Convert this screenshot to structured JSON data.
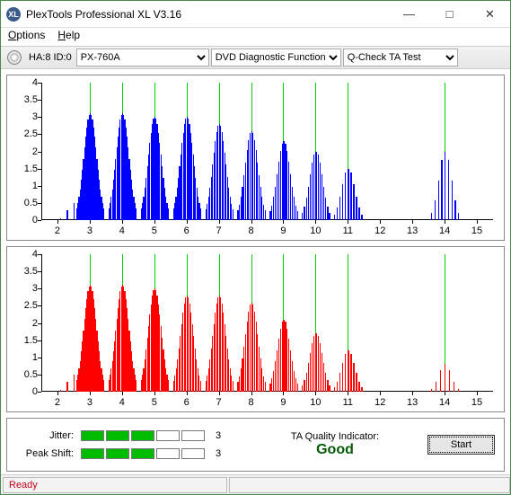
{
  "window": {
    "title": "PlexTools Professional XL V3.16",
    "icon_text": "XL",
    "minimize": "—",
    "maximize": "□",
    "close": "✕"
  },
  "menu": {
    "options": "Options",
    "options_u": "O",
    "help": "Help",
    "help_u": "H"
  },
  "toolbar": {
    "drive_label": "HA:8 ID:0",
    "drive_model": "PX-760A",
    "func": "DVD Diagnostic Functions",
    "test": "Q-Check TA Test"
  },
  "chart_data": [
    {
      "type": "bar",
      "color": "#0000ff",
      "xlim": [
        1.5,
        15.5
      ],
      "ylim": [
        0,
        4
      ],
      "xticks": [
        2,
        3,
        4,
        5,
        6,
        7,
        8,
        9,
        10,
        11,
        12,
        13,
        14,
        15
      ],
      "yticks": [
        0,
        0.5,
        1,
        1.5,
        2,
        2.5,
        3,
        3.5,
        4
      ],
      "vlines": [
        3,
        4,
        5,
        6,
        7,
        8,
        9,
        10,
        11,
        14
      ],
      "clusters": [
        {
          "center": 2.5,
          "npts": 5,
          "peak": 0.5
        },
        {
          "center": 3,
          "npts": 25,
          "peak": 3.1
        },
        {
          "center": 4,
          "npts": 25,
          "peak": 3.1
        },
        {
          "center": 5,
          "npts": 23,
          "peak": 3.0
        },
        {
          "center": 6,
          "npts": 23,
          "peak": 3.0
        },
        {
          "center": 7,
          "npts": 21,
          "peak": 2.8
        },
        {
          "center": 8,
          "npts": 19,
          "peak": 2.6
        },
        {
          "center": 9,
          "npts": 17,
          "peak": 2.3
        },
        {
          "center": 10,
          "npts": 15,
          "peak": 2.0
        },
        {
          "center": 11,
          "npts": 11,
          "peak": 1.5
        },
        {
          "center": 14,
          "npts": 9,
          "peak": 2.0
        }
      ]
    },
    {
      "type": "bar",
      "color": "#ff0000",
      "xlim": [
        1.5,
        15.5
      ],
      "ylim": [
        0,
        4
      ],
      "xticks": [
        2,
        3,
        4,
        5,
        6,
        7,
        8,
        9,
        10,
        11,
        12,
        13,
        14,
        15
      ],
      "yticks": [
        0,
        0.5,
        1,
        1.5,
        2,
        2.5,
        3,
        3.5,
        4
      ],
      "vlines": [
        3,
        4,
        5,
        6,
        7,
        8,
        9,
        10,
        11,
        14
      ],
      "clusters": [
        {
          "center": 2.5,
          "npts": 5,
          "peak": 0.5
        },
        {
          "center": 3,
          "npts": 25,
          "peak": 3.1
        },
        {
          "center": 4,
          "npts": 25,
          "peak": 3.1
        },
        {
          "center": 5,
          "npts": 23,
          "peak": 3.0
        },
        {
          "center": 6,
          "npts": 21,
          "peak": 2.8
        },
        {
          "center": 7,
          "npts": 21,
          "peak": 2.8
        },
        {
          "center": 8,
          "npts": 19,
          "peak": 2.6
        },
        {
          "center": 9,
          "npts": 17,
          "peak": 2.1
        },
        {
          "center": 10,
          "npts": 15,
          "peak": 1.7
        },
        {
          "center": 11,
          "npts": 11,
          "peak": 1.2
        },
        {
          "center": 14,
          "npts": 7,
          "peak": 0.8
        }
      ]
    }
  ],
  "meters": {
    "jitter_label": "Jitter:",
    "jitter_value": "3",
    "jitter_filled": 3,
    "peak_label": "Peak Shift:",
    "peak_value": "3",
    "peak_filled": 3,
    "total_blocks": 5
  },
  "ta": {
    "label": "TA Quality Indicator:",
    "value": "Good"
  },
  "buttons": {
    "start": "Start"
  },
  "status": {
    "text": "Ready"
  }
}
